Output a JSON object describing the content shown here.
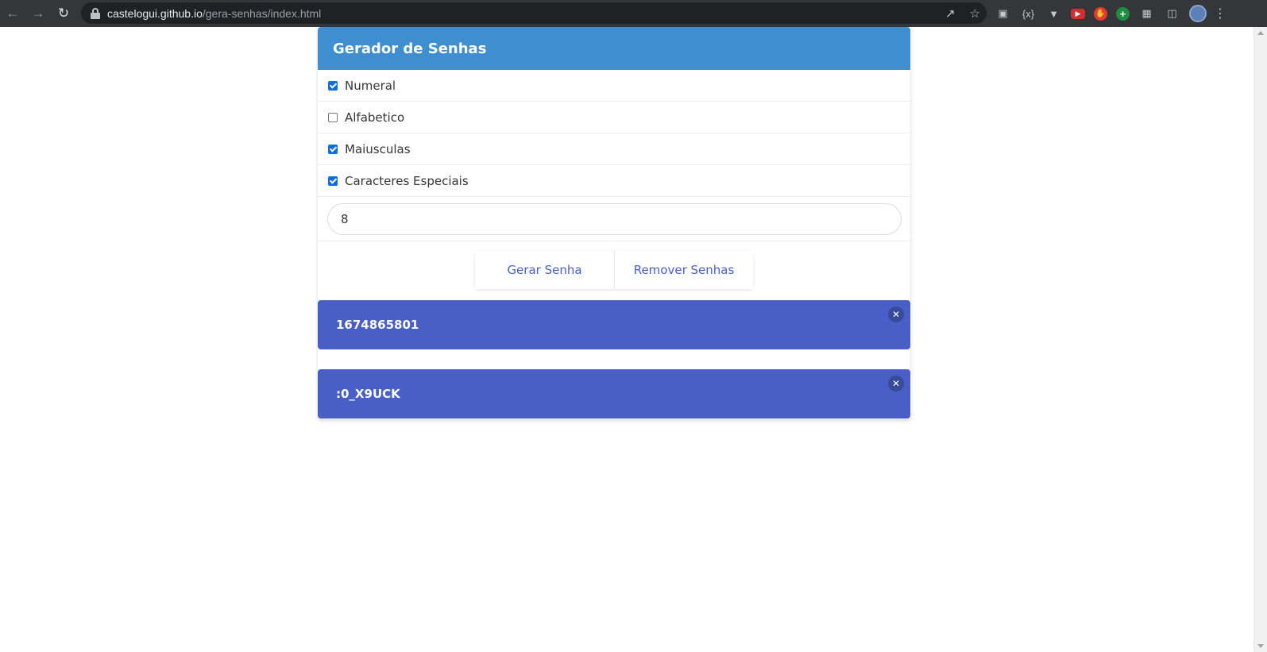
{
  "browser": {
    "url_host": "castelogui.github.io",
    "url_path": "/gera-senhas/index.html"
  },
  "app": {
    "title": "Gerador de Senhas",
    "options": [
      {
        "label": "Numeral",
        "checked": true
      },
      {
        "label": "Alfabetico",
        "checked": false
      },
      {
        "label": "Maiusculas",
        "checked": true
      },
      {
        "label": "Caracteres Especiais",
        "checked": true
      }
    ],
    "length_value": "8",
    "generate_label": "Gerar Senha",
    "remove_label": "Remover Senhas",
    "passwords": [
      "1674865801",
      ":0_X9UCK"
    ]
  },
  "colors": {
    "header": "#3e8ed0",
    "password_bg": "#485fc7",
    "button_text": "#485fc7",
    "checkbox": "#0b6ee0"
  }
}
